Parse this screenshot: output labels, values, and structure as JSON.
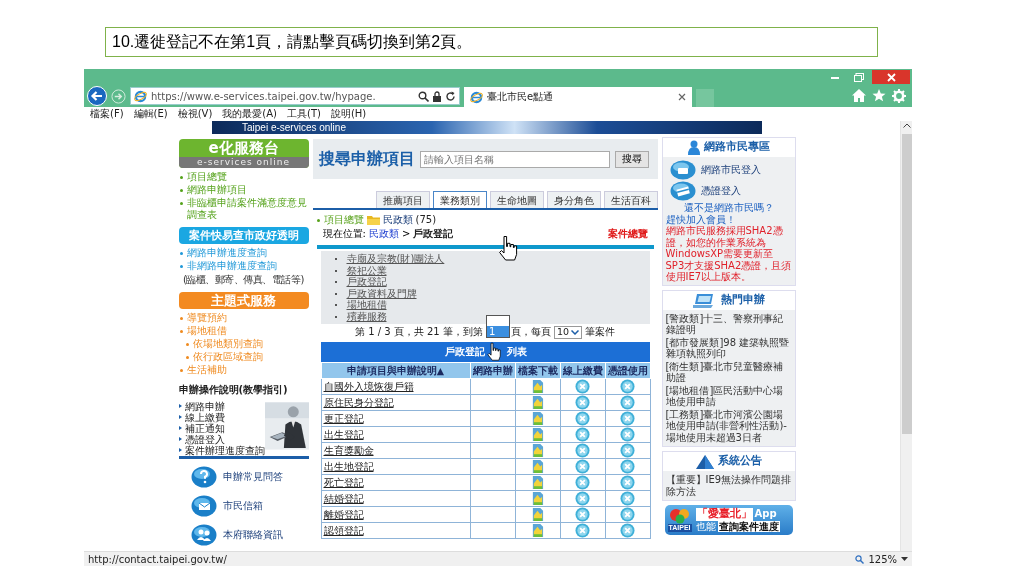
{
  "instruction": "10.遷徙登記不在第1頁，請點擊頁碼切換到第2頁。",
  "browser": {
    "url": "https://www.e-services.taipei.gov.tw/hypage.",
    "tab_title": "臺北市民e點通",
    "menu": [
      "檔案(F)",
      "編輯(E)",
      "檢視(V)",
      "我的最愛(A)",
      "工具(T)",
      "說明(H)"
    ],
    "status_url": "http://contact.taipei.gov.tw/",
    "zoom": "125%"
  },
  "banner": {
    "title": "Taipei e-services online"
  },
  "left_nav": {
    "logo": {
      "title": "e化服務台",
      "subtitle": "e-services online"
    },
    "service_links": [
      {
        "label": "項目總覽"
      },
      {
        "label": "網路申辦項目"
      },
      {
        "label": "非臨櫃申請案件滿意度意見調查表"
      }
    ],
    "progress": {
      "title": "案件快易查市政好透明",
      "links": [
        {
          "label": "網路申辦進度查詢"
        },
        {
          "label": "非網路申辦進度查詢"
        }
      ],
      "note": "(臨櫃、郵寄、傳真、電話等)"
    },
    "themes": {
      "title": "主題式服務",
      "links": [
        {
          "label": "導覽預約"
        },
        {
          "label": "場地租借",
          "children": [
            {
              "label": "依場地類別查詢"
            },
            {
              "label": "依行政區域查詢"
            }
          ]
        },
        {
          "label": "生活補助"
        }
      ]
    },
    "tutorial": {
      "title": "申辦操作說明(教學指引)",
      "links": [
        "網路申辦",
        "線上繳費",
        "補正通知",
        "憑證登入",
        "案件辦理進度查詢"
      ]
    },
    "quick_links": [
      {
        "label": "申辦常見問答",
        "kind": "faq"
      },
      {
        "label": "市民信箱",
        "kind": "mail"
      },
      {
        "label": "本府聯絡資訊",
        "kind": "contact"
      }
    ]
  },
  "main": {
    "search": {
      "title": "搜尋申辦項目",
      "placeholder": "請輸入項目名稱",
      "button": "搜尋"
    },
    "tabs": [
      {
        "label": "推薦項目",
        "selected": false
      },
      {
        "label": "業務類別",
        "selected": true
      },
      {
        "label": "生命地圖",
        "selected": false
      },
      {
        "label": "身分角色",
        "selected": false
      },
      {
        "label": "生活百科",
        "selected": false
      }
    ],
    "category": {
      "overview": "項目總覽",
      "name": "民政類",
      "count": "(75)"
    },
    "breadcrumb": {
      "prefix": "現在位置:",
      "link": "民政類",
      "separator": ">",
      "current": "戶政登記",
      "overview": "案件總覽"
    },
    "subcategories": [
      "寺廟及宗教(財)團法人",
      "祭祀公業",
      "戶政登記",
      "戶政資料及門牌",
      "場地租借",
      "殯葬服務"
    ],
    "pagination": {
      "info": "第 1 / 3 頁，共 21 筆，到第",
      "options": [
        {
          "label": "1",
          "selected": true
        }
      ],
      "after": "頁，每頁",
      "per_page": "10",
      "suffix": "筆案件"
    },
    "table": {
      "caption": [
        "戶政登記",
        "列表"
      ],
      "columns": [
        "申請項目與申辦說明▲",
        "網路申辦",
        "檔案下載",
        "線上繳費",
        "憑證使用"
      ],
      "rows": [
        {
          "name": "自國外入境恢復戶籍",
          "download": true,
          "payment": false,
          "certificate": false
        },
        {
          "name": "原住民身分登記",
          "download": true,
          "payment": false,
          "certificate": false
        },
        {
          "name": "更正登記",
          "download": true,
          "payment": false,
          "certificate": false
        },
        {
          "name": "出生登記",
          "download": true,
          "payment": false,
          "certificate": false
        },
        {
          "name": "生育獎勵金",
          "download": true,
          "payment": false,
          "certificate": false
        },
        {
          "name": "出生地登記",
          "download": true,
          "payment": false,
          "certificate": false
        },
        {
          "name": "死亡登記",
          "download": true,
          "payment": false,
          "certificate": false
        },
        {
          "name": "結婚登記",
          "download": true,
          "payment": false,
          "certificate": false
        },
        {
          "name": "離婚登記",
          "download": true,
          "payment": false,
          "certificate": false
        },
        {
          "name": "認領登記",
          "download": true,
          "payment": false,
          "certificate": false
        }
      ]
    }
  },
  "right": {
    "member": {
      "title": "網路市民專區",
      "logins": [
        {
          "label": "網路市民登入",
          "kind": "citizen"
        },
        {
          "label": "憑證登入",
          "kind": "certificate"
        }
      ],
      "prompt": "還不是網路市民嗎？",
      "join": "趕快加入會員！",
      "notice": "網路市民服務採用SHA2憑證，如您的作業系統為WindowsXP需要更新至SP3才支援SHA2憑證，且須使用IE7以上版本。"
    },
    "hot": {
      "title": "熱門申辦",
      "items": [
        "[警政類]十三、警察刑事紀錄證明",
        "[都市發展類]98 建築執照暨雜項執照列印",
        "[衛生類]臺北市兒童醫療補助證",
        "[場地租借]區民活動中心場地使用申請",
        "[工務類]臺北市河濱公園場地使用申請(非營利性活動)-場地使用未超過3日者"
      ]
    },
    "announcements": {
      "title": "系統公告",
      "items": [
        "【重要】IE9無法操作問題排除方法"
      ]
    },
    "app": {
      "logo_text": "TAIPEI",
      "name": "「愛臺北」",
      "suffix": "App",
      "prefix": "也能",
      "tagline": "查詢案件進度"
    }
  }
}
